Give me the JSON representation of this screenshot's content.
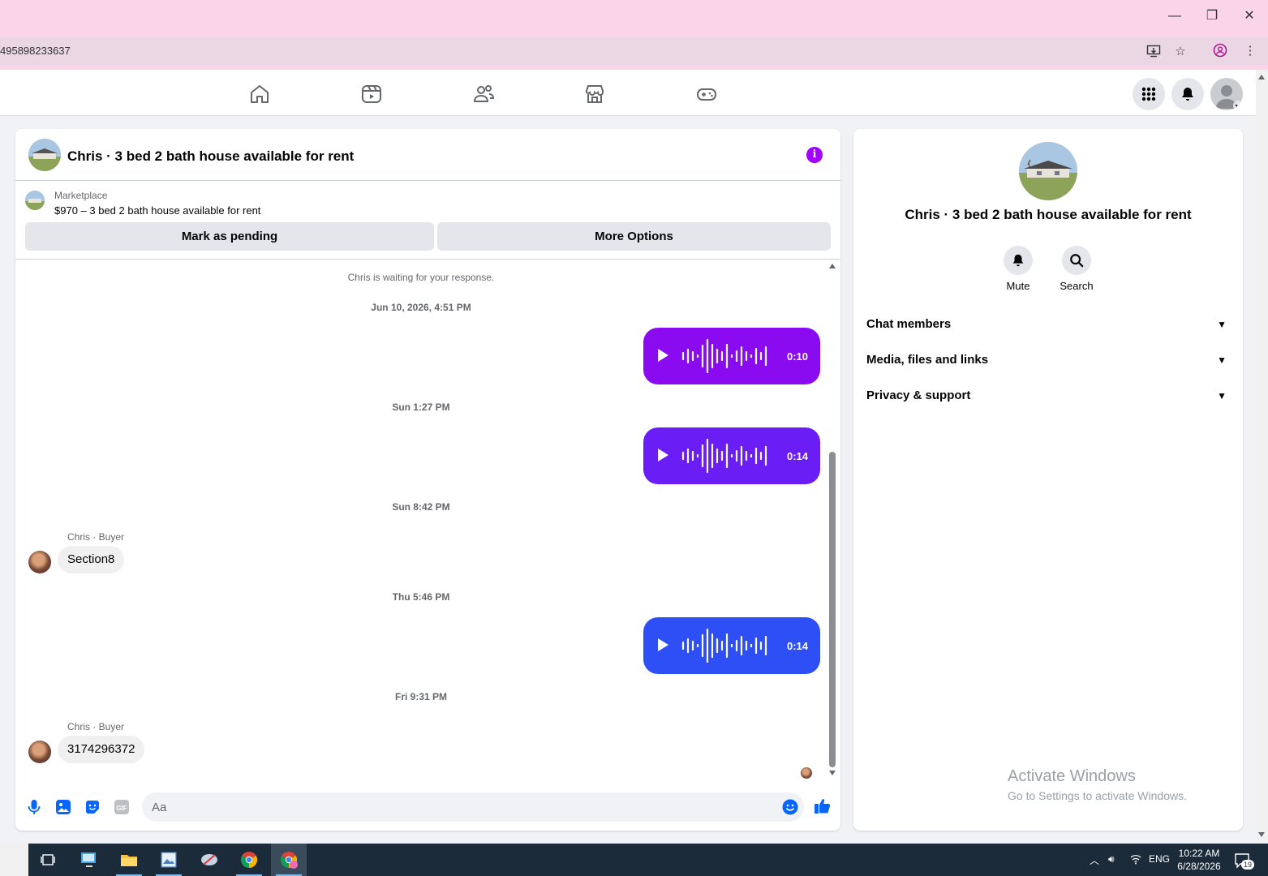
{
  "browser": {
    "url_fragment": "495898233637",
    "accent": "#fad4e8"
  },
  "chat": {
    "title": "Chris · 3 bed 2 bath house available for rent",
    "listing": {
      "source": "Marketplace",
      "price_title": "$970 – 3 bed 2 bath house available for rent",
      "pending_label": "Mark as pending",
      "more_label": "More Options"
    },
    "waiting_note": "Chris is waiting for your response.",
    "timeline": {
      "ts1": "Jun 10, 2026, 4:51 PM",
      "voice1": "0:10",
      "ts2": "Sun 1:27 PM",
      "voice2": "0:14",
      "ts3": "Sun 8:42 PM",
      "sender1": "Chris · Buyer",
      "msg1": "Section8",
      "ts4": "Thu 5:46 PM",
      "voice3": "0:14",
      "ts5": "Fri 9:31 PM",
      "sender2": "Chris · Buyer",
      "msg2": "3174296372"
    },
    "composer_placeholder": "Aa",
    "colors": {
      "voice1": "#8a0bf0",
      "voice2": "#6a1ef5",
      "voice3": "#2e4ff5",
      "accent_info": "#a100ff",
      "icon_blue": "#0866ff"
    }
  },
  "side": {
    "title": "Chris · 3 bed 2 bath house available for rent",
    "mute_label": "Mute",
    "search_label": "Search",
    "sections": [
      "Chat members",
      "Media, files and links",
      "Privacy & support"
    ]
  },
  "watermark": {
    "line1": "Activate Windows",
    "line2": "Go to Settings to activate Windows."
  },
  "taskbar": {
    "lang": "ENG",
    "time": "10:22 AM",
    "date": "6/28/2026",
    "notif_count": "19"
  }
}
